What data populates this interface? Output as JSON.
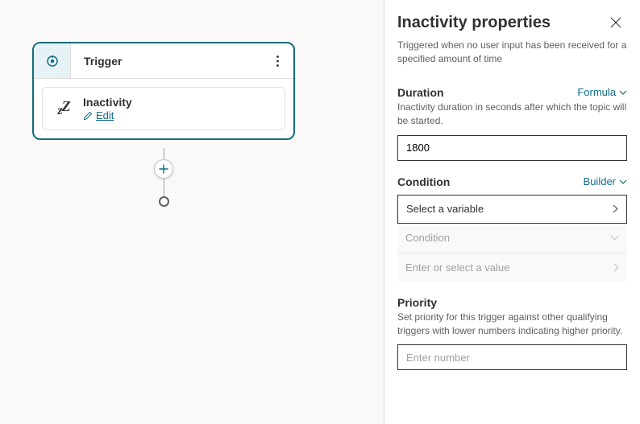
{
  "node": {
    "title": "Trigger",
    "card": {
      "title": "Inactivity",
      "edit": "Edit"
    }
  },
  "panel": {
    "title": "Inactivity properties",
    "description": "Triggered when no user input has been received for a specified amount of time"
  },
  "duration": {
    "label": "Duration",
    "mode": "Formula",
    "help": "Inactivity duration in seconds after which the topic will be started.",
    "value": "1800"
  },
  "condition": {
    "label": "Condition",
    "mode": "Builder",
    "var_placeholder": "Select a variable",
    "op_placeholder": "Condition",
    "val_placeholder": "Enter or select a value"
  },
  "priority": {
    "label": "Priority",
    "help": "Set priority for this trigger against other qualifying triggers with lower numbers indicating higher priority.",
    "placeholder": "Enter number"
  }
}
